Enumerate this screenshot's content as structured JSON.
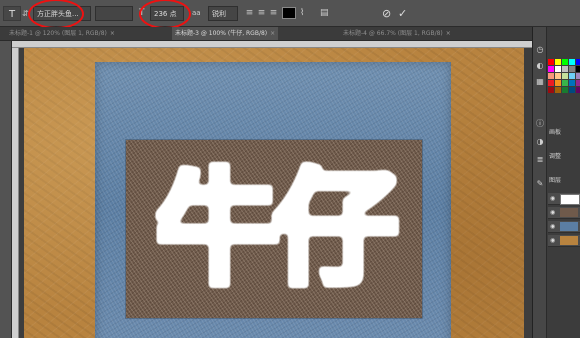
{
  "options_bar": {
    "tool_icon": "T",
    "font_family": "方正胖头鱼...",
    "font_size": "236 点",
    "aa_label": "aa",
    "aa_mode": "锐利",
    "text_color": "#000000",
    "cancel_icon": "⊘",
    "commit_icon": "✓"
  },
  "tabs": [
    {
      "label": "未标题-1 @ 120% (图层 1, RGB/8)",
      "active": false
    },
    {
      "label": "未标题-3 @ 100% (牛仔, RGB/8)",
      "active": true
    },
    {
      "label": "未标题-4 @ 66.7% (图层 1, RGB/8)",
      "active": false
    }
  ],
  "canvas": {
    "text": "牛仔"
  },
  "right_dock": {
    "panel_label_1": "画板",
    "panel_label_2": "调整",
    "panel_label_3": "图层"
  },
  "colors": {
    "highlight": "#ee1111",
    "leather": "#b8833f",
    "denim": "#5b7ea3",
    "text_fill": "#ffffff"
  }
}
